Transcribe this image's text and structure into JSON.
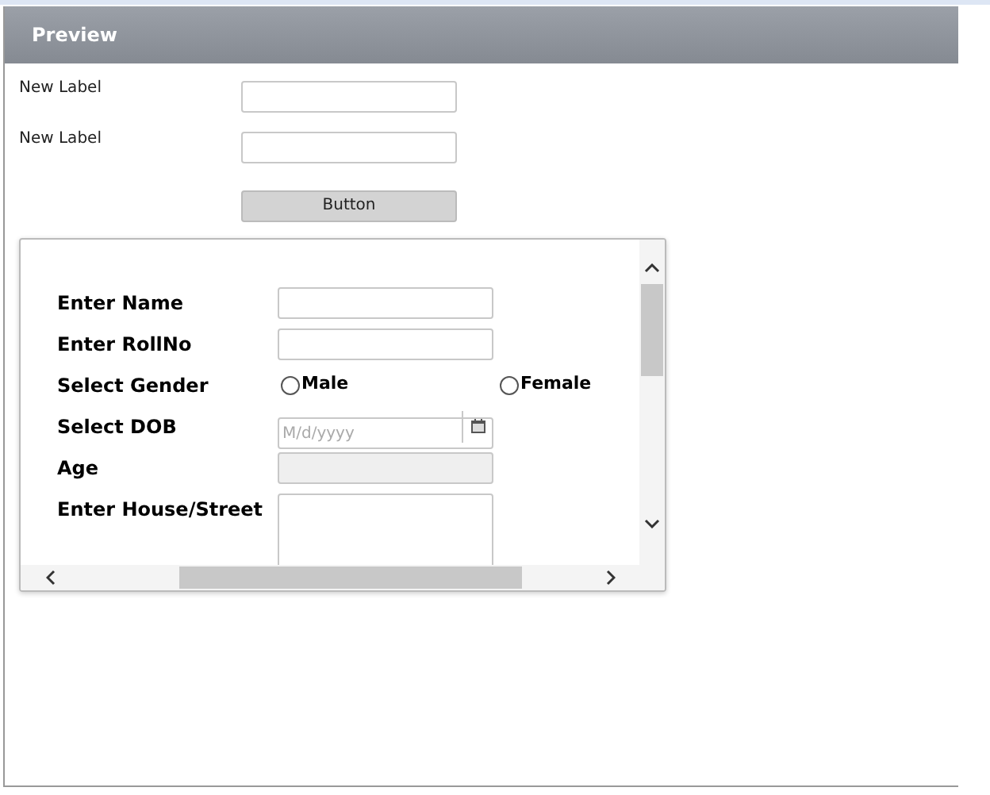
{
  "panel": {
    "title": "Preview"
  },
  "fields": [
    {
      "label": "New Label"
    },
    {
      "label": "New Label"
    }
  ],
  "button": "Button",
  "form": {
    "rows": [
      {
        "kind": "text",
        "label": "Enter Name"
      },
      {
        "kind": "text",
        "label": "Enter RollNo"
      },
      {
        "kind": "radio",
        "label": "Select Gender",
        "options": [
          {
            "label": "Male",
            "selected": false
          },
          {
            "label": "Female",
            "selected": false
          }
        ]
      },
      {
        "kind": "date",
        "label": "Select DOB",
        "placeholder": "M/d/yyyy"
      },
      {
        "kind": "readonly",
        "label": "Age"
      },
      {
        "kind": "textarea",
        "label": "Enter House/Street"
      }
    ]
  }
}
